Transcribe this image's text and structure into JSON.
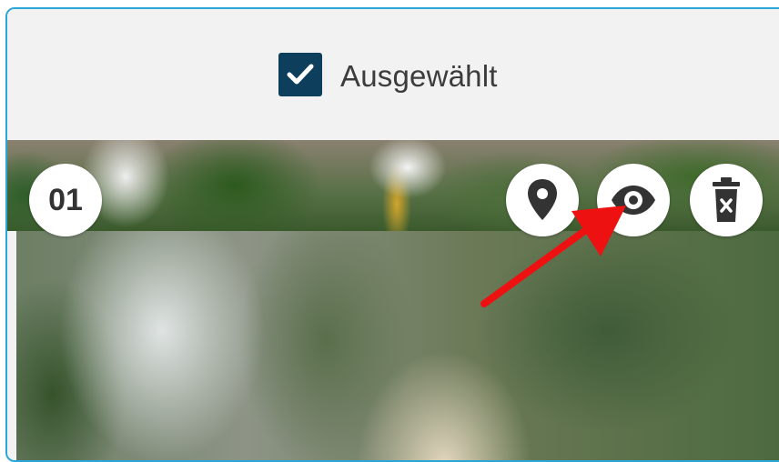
{
  "selection": {
    "label": "Ausgewählt",
    "checked": true
  },
  "photo": {
    "number": "01"
  },
  "actions": [
    {
      "name": "location",
      "icon": "map-pin-icon"
    },
    {
      "name": "preview",
      "icon": "eye-icon"
    },
    {
      "name": "delete",
      "icon": "trash-icon"
    }
  ],
  "colors": {
    "border": "#2aa6d8",
    "checkbox": "#0d3e5c",
    "icon": "#333333",
    "annotation": "#ee1111"
  }
}
